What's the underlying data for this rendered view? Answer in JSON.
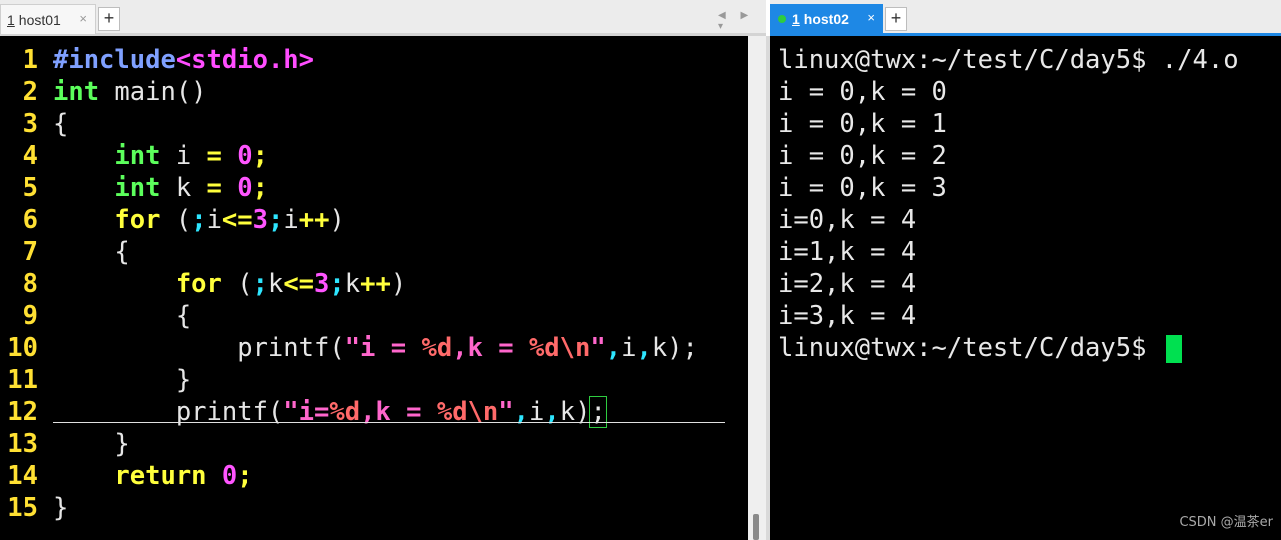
{
  "tabs": {
    "left": {
      "number": "1",
      "title": "host01",
      "close": "×",
      "add": "+"
    },
    "right": {
      "number": "1",
      "title": "host02",
      "close": "×",
      "add": "+"
    }
  },
  "tab_arrows": "◀ ▶ ▾",
  "editor": {
    "line_numbers": [
      "1",
      "2",
      "3",
      "4",
      "5",
      "6",
      "7",
      "8",
      "9",
      "10",
      "11",
      "12",
      "13",
      "14",
      "15"
    ],
    "lines": [
      [
        {
          "t": "#include",
          "c": "pp"
        },
        {
          "t": "<stdio.h>",
          "c": "mag"
        }
      ],
      [
        {
          "t": "int",
          "c": "green"
        },
        {
          "t": " main()",
          "c": ""
        }
      ],
      [
        {
          "t": "{",
          "c": ""
        }
      ],
      [
        {
          "t": "    ",
          "c": ""
        },
        {
          "t": "int",
          "c": "green"
        },
        {
          "t": " i ",
          "c": ""
        },
        {
          "t": "=",
          "c": "yellow"
        },
        {
          "t": " ",
          "c": ""
        },
        {
          "t": "0",
          "c": "num"
        },
        {
          "t": ";",
          "c": "yellow"
        }
      ],
      [
        {
          "t": "    ",
          "c": ""
        },
        {
          "t": "int",
          "c": "green"
        },
        {
          "t": " k ",
          "c": ""
        },
        {
          "t": "=",
          "c": "yellow"
        },
        {
          "t": " ",
          "c": ""
        },
        {
          "t": "0",
          "c": "num"
        },
        {
          "t": ";",
          "c": "yellow"
        }
      ],
      [
        {
          "t": "    ",
          "c": ""
        },
        {
          "t": "for",
          "c": "yellow"
        },
        {
          "t": " (",
          "c": ""
        },
        {
          "t": ";",
          "c": "cyan"
        },
        {
          "t": "i",
          "c": ""
        },
        {
          "t": "<=",
          "c": "yellow"
        },
        {
          "t": "3",
          "c": "num"
        },
        {
          "t": ";",
          "c": "cyan"
        },
        {
          "t": "i",
          "c": ""
        },
        {
          "t": "++",
          "c": "yellow"
        },
        {
          "t": ")",
          "c": ""
        }
      ],
      [
        {
          "t": "    {",
          "c": ""
        }
      ],
      [
        {
          "t": "        ",
          "c": ""
        },
        {
          "t": "for",
          "c": "yellow"
        },
        {
          "t": " (",
          "c": ""
        },
        {
          "t": ";",
          "c": "cyan"
        },
        {
          "t": "k",
          "c": ""
        },
        {
          "t": "<=",
          "c": "yellow"
        },
        {
          "t": "3",
          "c": "num"
        },
        {
          "t": ";",
          "c": "cyan"
        },
        {
          "t": "k",
          "c": ""
        },
        {
          "t": "++",
          "c": "yellow"
        },
        {
          "t": ")",
          "c": ""
        }
      ],
      [
        {
          "t": "        {",
          "c": ""
        }
      ],
      [
        {
          "t": "            printf(",
          "c": ""
        },
        {
          "t": "\"i = ",
          "c": "str"
        },
        {
          "t": "%d",
          "c": "fmt"
        },
        {
          "t": ",k = ",
          "c": "str"
        },
        {
          "t": "%d",
          "c": "fmt"
        },
        {
          "t": "\\n",
          "c": "fmt"
        },
        {
          "t": "\"",
          "c": "str"
        },
        {
          "t": ",",
          "c": "cyan"
        },
        {
          "t": "i",
          "c": ""
        },
        {
          "t": ",",
          "c": "cyan"
        },
        {
          "t": "k);",
          "c": ""
        }
      ],
      [
        {
          "t": "        }",
          "c": ""
        }
      ],
      [
        {
          "t": "        printf(",
          "c": ""
        },
        {
          "t": "\"i=",
          "c": "str"
        },
        {
          "t": "%d",
          "c": "fmt"
        },
        {
          "t": ",k = ",
          "c": "str"
        },
        {
          "t": "%d",
          "c": "fmt"
        },
        {
          "t": "\\n",
          "c": "fmt"
        },
        {
          "t": "\"",
          "c": "str"
        },
        {
          "t": ",",
          "c": "cyan"
        },
        {
          "t": "i",
          "c": ""
        },
        {
          "t": ",",
          "c": "cyan"
        },
        {
          "t": "k)",
          "c": ""
        },
        {
          "t": ";",
          "c": "",
          "cursor": true
        }
      ],
      [
        {
          "t": "    }",
          "c": ""
        }
      ],
      [
        {
          "t": "    ",
          "c": ""
        },
        {
          "t": "return",
          "c": "yellow"
        },
        {
          "t": " ",
          "c": ""
        },
        {
          "t": "0",
          "c": "num"
        },
        {
          "t": ";",
          "c": "yellow"
        }
      ],
      [
        {
          "t": "}",
          "c": ""
        }
      ]
    ]
  },
  "terminal": {
    "lines": [
      "linux@twx:~/test/C/day5$ ./4.o",
      "i = 0,k = 0",
      "i = 0,k = 1",
      "i = 0,k = 2",
      "i = 0,k = 3",
      "i=0,k = 4",
      "i=1,k = 4",
      "i=2,k = 4",
      "i=3,k = 4",
      "linux@twx:~/test/C/day5$ "
    ]
  },
  "watermark": "CSDN @温茶er",
  "colors": {
    "active_tab": "#1e88e5",
    "terminal_bg": "#000000",
    "line_number": "#ffe033",
    "type_keyword": "#5cff5c",
    "control_keyword": "#ffff3c",
    "preprocessor": "#7fa0ff",
    "string": "#ff66cc",
    "cursor": "#00e050"
  }
}
